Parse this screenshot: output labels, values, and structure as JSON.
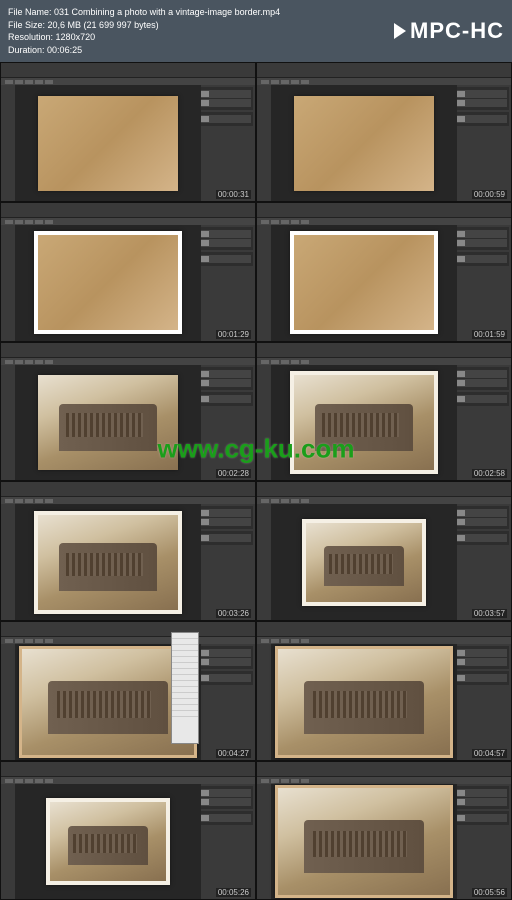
{
  "header": {
    "file_name_label": "File Name:",
    "file_name": "031 Combining a photo with a vintage-image border.mp4",
    "file_size_label": "File Size:",
    "file_size": "20,6 MB (21 699 997 bytes)",
    "resolution_label": "Resolution:",
    "resolution": "1280x720",
    "duration_label": "Duration:",
    "duration": "00:06:25",
    "logo": "MPC-HC"
  },
  "watermark": "www.cg-ku.com",
  "cells": [
    {
      "time": "00:00:31"
    },
    {
      "time": "00:00:59"
    },
    {
      "time": "00:01:29"
    },
    {
      "time": "00:01:59"
    },
    {
      "time": "00:02:28"
    },
    {
      "time": "00:02:58"
    },
    {
      "time": "00:03:26"
    },
    {
      "time": "00:03:57"
    },
    {
      "time": "00:04:27"
    },
    {
      "time": "00:04:57"
    },
    {
      "time": "00:05:26"
    },
    {
      "time": "00:05:56"
    }
  ]
}
